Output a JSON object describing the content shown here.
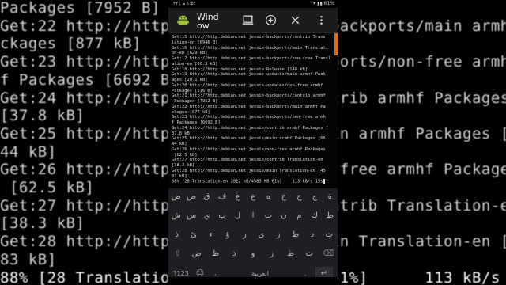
{
  "background_terminal": [
    "Packages [7952 B]",
    "Get:22 http://http.de              backports/main armhf Pa",
    "ckages [877 kB]",
    "Get:23 http://http.de              ports/non-free armhf",
    "f Packages [6692 B]",
    "Get:24 http://http.de              trib armhf Packages",
    "[37.8 kB]",
    "Get:25 http://http.de              in armhf Packages [66",
    "44 kB]",
    "Get:26 http://http.de              -free armhf Packages",
    " [62.5 kB]",
    "Get:27 http://http.de              ntrib Translation-en",
    "[38.3 kB]",
    "Get:28 http://http.de              in Translation-en [45",
    "83 kB]",
    "88% [28 Translation-e              51%]      113 kB/s 15s"
  ],
  "statusbar": {
    "time": "١:٥٢ م  ٣٢٤",
    "right": "▾ ▮▮ 61%"
  },
  "window": {
    "title": "Wind\now",
    "app_icon": "android-icon",
    "icons": [
      "terminal-icon",
      "add-icon",
      "close-icon",
      "more-vert-icon"
    ]
  },
  "terminal_lines": [
    "Get:15 http://http.debian.net jessie-backports/contrib Trans",
    "lation-en [6946 B]",
    "Get:16 http://http.debian.net jessie-backports/main Translati",
    "on-en [629 kB]",
    "Get:17 http://http.debian.net jessie-backports/non-free Transl",
    "ation-en [30.3 kB]",
    "Get:18 http://http.debian.net jessie Release [148 kB]",
    "Get:19 http://http.debian.net jessie-updates/main armhf Pack",
    "ages [20.1 kB]",
    "Get:20 http://http.debian.net jessie-updates/non-free armhf",
    "Packages [516 B]",
    "Get:21 http://http.debian.net jessie-backports/contrib armhf",
    " Packages [7952 B]",
    "Get:22 http://http.debian.net jessie-backports/main armhf Pa",
    "ckages [877 kB]",
    "Get:23 http://http.debian.net jessie-backports/non-free armh",
    "f Packages [6692 B]",
    "Get:24 http://http.debian.net jessie/contrib armhf Packages [",
    "37.8 kB]",
    "Get:25 http://http.debian.net jessie/main armhf Packages [66",
    "44 kB]",
    "Get:26 http://http.debian.net jessie/non-free armhf Packages",
    " [62.5 kB]",
    "Get:27 http://http.debian.net jessie/contrib Translation-en",
    "[38.3 kB]",
    "Get:28 http://http.debian.net jessie/main Translation-en [45",
    "83 kB]",
    "88% [28 Translation-en 2812 kB/4583 kB 61%]    113 kB/s 15s"
  ],
  "keyboard": {
    "row1": [
      "ض",
      "ص",
      "ق",
      "ف",
      "غ",
      "ع",
      "ه",
      "خ",
      "ح",
      "ج",
      "ة"
    ],
    "row2": [
      "ش",
      "س",
      "ي",
      "ب",
      "ل",
      "ا",
      "ت",
      "ن",
      "م",
      "ك",
      "ط"
    ],
    "row3": [
      "ذ",
      "ئ",
      "ء",
      "ؤ",
      "ر",
      "ى",
      "ز",
      "ظ",
      "د",
      "ث"
    ],
    "row4": [
      "⇧",
      "ض",
      "ظ",
      "ذ",
      "و",
      "ز",
      "ظ",
      "ث",
      "⌫"
    ],
    "bottom": {
      "symbols": "?123",
      "emoji": "☺",
      "comma": "،",
      "space": "العربية",
      "period": ".",
      "enter": "↵"
    }
  }
}
